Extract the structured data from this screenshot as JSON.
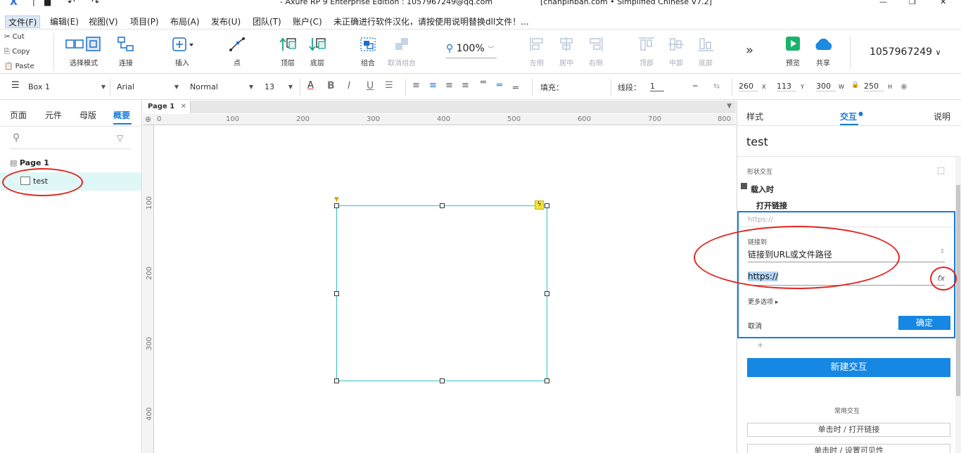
{
  "window": {
    "title": "- Axure RP 9 Enterprise Edition : 1057967249@qq.com",
    "title_right": "[chanpinban.com • Simplified Chinese V7.2]"
  },
  "menu": [
    "文件(F)",
    "编辑(E)",
    "视图(V)",
    "项目(P)",
    "布局(A)",
    "发布(U)",
    "团队(T)",
    "账户(C)"
  ],
  "menu_notice": "未正确进行软件汉化，请按使用说明替换dll文件！...",
  "clipboard": {
    "cut": "Cut",
    "copy": "Copy",
    "paste": "Paste"
  },
  "toolbar": {
    "select_mode": "选择模式",
    "connect": "连接",
    "insert": "插入",
    "point": "点",
    "top_layer": "顶层",
    "bottom_layer": "底层",
    "group": "组合",
    "ungroup": "取消组合",
    "zoom": "100%",
    "align_left": "左侧",
    "align_center": "居中",
    "align_right": "右侧",
    "align_top": "顶部",
    "align_middle": "中部",
    "align_bottom": "底部",
    "preview": "预览",
    "share": "共享",
    "account": "1057967249"
  },
  "format": {
    "widget_name": "Box 1",
    "font": "Arial",
    "weight": "Normal",
    "size": "13",
    "fill_label": "填充：",
    "line_label": "线段：",
    "line_value": "1",
    "x": "260",
    "x_label": "X",
    "y": "113",
    "y_label": "Y",
    "w": "300",
    "w_label": "W",
    "h": "250",
    "h_label": "H"
  },
  "left_panel": {
    "tabs": [
      "页面",
      "元件",
      "母版",
      "概要"
    ],
    "active_tab": "概要",
    "page": "Page 1",
    "item": "test"
  },
  "canvas": {
    "page_tab": "Page 1",
    "h_ticks": [
      "0",
      "100",
      "200",
      "300",
      "400",
      "500",
      "600",
      "700",
      "800"
    ],
    "v_ticks": [
      "100",
      "200",
      "300",
      "400"
    ]
  },
  "right_panel": {
    "tabs": [
      "样式",
      "交互",
      "说明"
    ],
    "active_tab": "交互",
    "widget_name": "test",
    "section_label": "形状交互",
    "event": "载入时",
    "action": "打开链接",
    "url_preview": "https://",
    "link_to_label": "链接到",
    "link_to_value": "链接到URL或文件路径",
    "url_value": "https://",
    "more_options": "更多选项",
    "cancel": "取消",
    "confirm": "确定",
    "new_interaction": "新建交互",
    "common_label": "常用交互",
    "common_1": "单击时 / 打开链接",
    "common_2": "单击时 / 设置可见性"
  },
  "colors": {
    "accent": "#1a7bd6",
    "button_blue": "#1687e2",
    "selection": "#2fc4c8",
    "annotation": "#e3241f"
  }
}
